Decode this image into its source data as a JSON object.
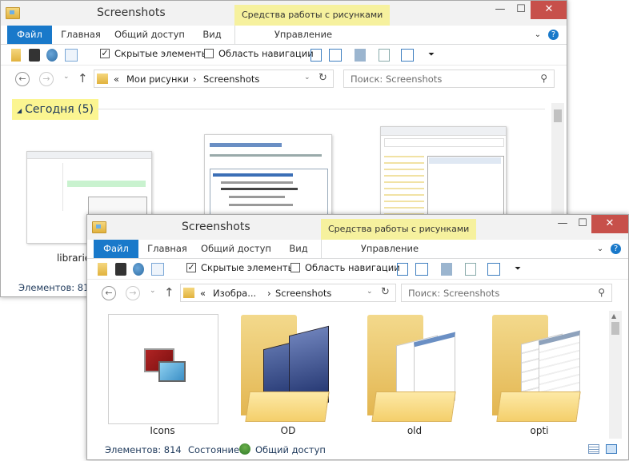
{
  "colors": {
    "file_tab": "#1979ca",
    "context_tab": "#f6f19e",
    "close": "#c7504a",
    "group_highlight": "#fbf591",
    "link": "#1e395b"
  },
  "back_window": {
    "title": "Screenshots",
    "context_tab": "Средства работы с рисунками",
    "controls": {
      "minimize": "—",
      "maximize": "☐",
      "close": "✕"
    },
    "ribbon_tabs": [
      "Файл",
      "Главная",
      "Общий доступ",
      "Вид",
      "Управление"
    ],
    "hidden_items_label": "Скрытые элементы",
    "nav_pane_label": "Область навигации",
    "breadcrumb": [
      "«",
      "Мои рисунки",
      "›",
      "Screenshots"
    ],
    "search_placeholder": "Поиск: Screenshots",
    "group_header": "Сегодня (5)",
    "items": [
      {
        "name": "libraries-fileH"
      }
    ],
    "status_items": "Элементов: 814"
  },
  "front_window": {
    "title": "Screenshots",
    "context_tab": "Средства работы с рисунками",
    "controls": {
      "minimize": "—",
      "maximize": "☐",
      "close": "✕"
    },
    "ribbon_tabs": [
      "Файл",
      "Главная",
      "Общий доступ",
      "Вид",
      "Управление"
    ],
    "hidden_items_label": "Скрытые элементы",
    "nav_pane_label": "Область навигации",
    "breadcrumb": [
      "«",
      "Изобра...",
      "›",
      "Screenshots"
    ],
    "search_placeholder": "Поиск: Screenshots",
    "items": [
      {
        "name": "Icons"
      },
      {
        "name": "OD"
      },
      {
        "name": "old"
      },
      {
        "name": "opti"
      }
    ],
    "status_items": "Элементов: 814",
    "status_state_label": "Состояние:",
    "status_state_value": "Общий доступ"
  },
  "icons": [
    "folder-icon",
    "check-icon",
    "network-icon",
    "back-icon",
    "forward-icon",
    "up-icon",
    "refresh-icon",
    "search-icon",
    "chevron-down-icon",
    "help-icon",
    "details-view-icon",
    "large-icons-view-icon"
  ]
}
